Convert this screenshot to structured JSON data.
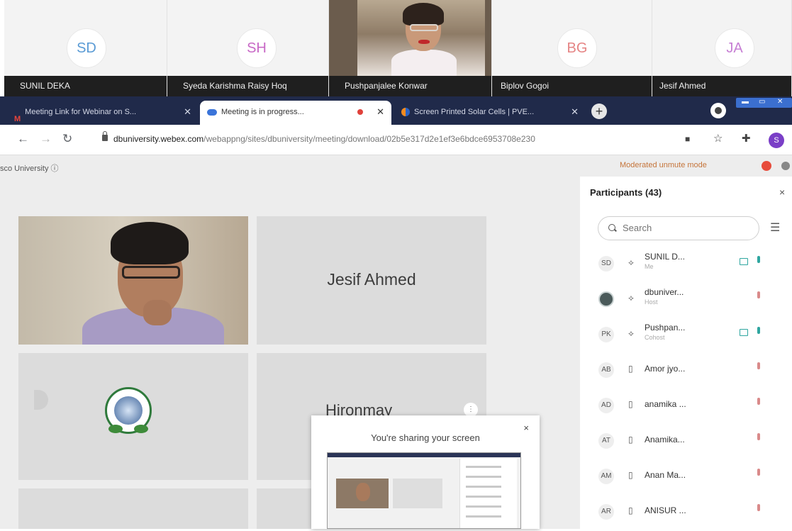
{
  "video_strip": [
    {
      "initials": "SD",
      "name": "SUNIL DEKA",
      "color": "#5a9bd5"
    },
    {
      "initials": "SH",
      "name": "Syeda Karishma Raisy Hoq",
      "color": "#c869c6"
    },
    {
      "initials": "",
      "name": "Pushpanjalee Konwar",
      "color": ""
    },
    {
      "initials": "BG",
      "name": "Biplov Gogoi",
      "color": "#e58484"
    },
    {
      "initials": "JA",
      "name": "Jesif Ahmed",
      "color": "#c77fd4"
    }
  ],
  "browser": {
    "tabs": [
      {
        "title": "Meeting Link for Webinar on S..."
      },
      {
        "title": "Meeting is in progress..."
      },
      {
        "title": "Screen Printed Solar Cells | PVE..."
      }
    ],
    "url_host": "dbuniversity.webex.com",
    "url_path": "/webappng/sites/dbuniversity/meeting/download/02b5e317d2e1ef3e6bdce6953708e230",
    "profile_initial": "S"
  },
  "app": {
    "org": "sco University ⓘ",
    "mode": "Moderated unmute mode",
    "grid": {
      "tile_jesif": "Jesif Ahmed",
      "tile_hiron": "Hironmay"
    },
    "share_popup": {
      "title": "You're sharing your screen",
      "close": "×"
    }
  },
  "participants": {
    "title": "Participants (43)",
    "close": "×",
    "search_placeholder": "Search",
    "list": [
      {
        "initials": "SD",
        "name": "SUNIL D...",
        "sub": "Me"
      },
      {
        "initials": "",
        "name": "dbuniver...",
        "sub": "Host"
      },
      {
        "initials": "PK",
        "name": "Pushpan...",
        "sub": "Cohost"
      },
      {
        "initials": "AB",
        "name": "Amor jyo...",
        "sub": ""
      },
      {
        "initials": "AD",
        "name": "anamika ...",
        "sub": ""
      },
      {
        "initials": "AT",
        "name": "Anamika...",
        "sub": ""
      },
      {
        "initials": "AM",
        "name": "Anan Ma...",
        "sub": ""
      },
      {
        "initials": "AR",
        "name": "ANISUR ...",
        "sub": ""
      }
    ]
  }
}
